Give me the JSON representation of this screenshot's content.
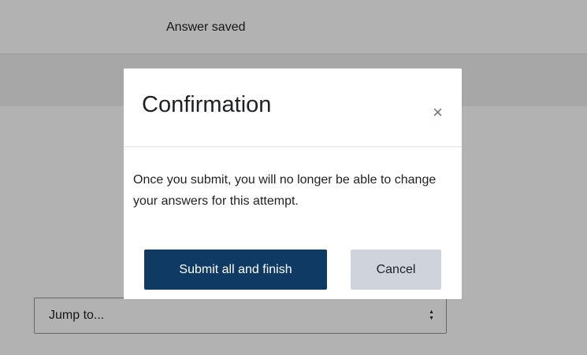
{
  "header": {
    "status_text": "Answer saved"
  },
  "navigation": {
    "jump_to_placeholder": "Jump to...",
    "jump_to_arrow_up": "▲",
    "jump_to_arrow_down": "▼"
  },
  "modal": {
    "title": "Confirmation",
    "close_symbol": "×",
    "body_text": "Once you submit, you will no longer be able to change your answers for this attempt.",
    "submit_label": "Submit all and finish",
    "cancel_label": "Cancel"
  },
  "colors": {
    "primary_button": "#0f3a63",
    "secondary_button": "#ced4da",
    "backdrop": "rgba(0,0,0,0.3)"
  }
}
